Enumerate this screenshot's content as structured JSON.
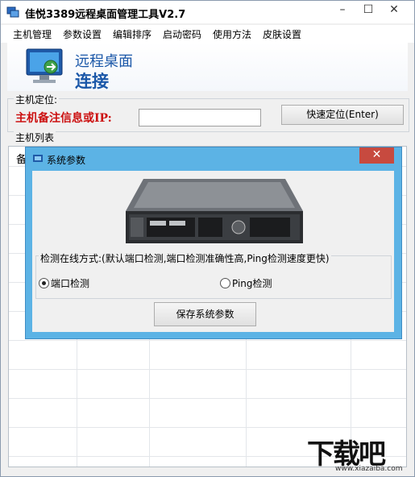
{
  "window": {
    "title": "佳悦3389远程桌面管理工具V2.7",
    "controls": {
      "minimize": "–",
      "maximize": "☐",
      "close": "✕"
    }
  },
  "menu": [
    {
      "label": "主机管理"
    },
    {
      "label": "参数设置"
    },
    {
      "label": "编辑排序"
    },
    {
      "label": "启动密码"
    },
    {
      "label": "使用方法"
    },
    {
      "label": "皮肤设置"
    }
  ],
  "banner": {
    "line1": "远程桌面",
    "line2": "连接",
    "icon": "remote-desktop-icon"
  },
  "locate": {
    "group_label": "主机定位:",
    "field_label": "主机备注信息或IP:",
    "input_value": "",
    "button_label": "快速定位(Enter)"
  },
  "host_list": {
    "group_label": "主机列表",
    "header_char": "备"
  },
  "dialog": {
    "title": "系统参数",
    "close": "✕",
    "image": "rack-server-image",
    "detect_label": "检测在线方式:(默认端口检测,端口检测准确性高,Ping检测速度更快)",
    "options": [
      {
        "label": "端口检测",
        "selected": true
      },
      {
        "label": "Ping检测",
        "selected": false
      }
    ],
    "save_button": "保存系统参数"
  },
  "watermark": {
    "text": "下载吧",
    "url": "www.xiazaiba.com"
  },
  "colors": {
    "accent": "#1a57a8",
    "red_label": "#cc1111",
    "dialog_frame": "#5cb3e5",
    "close_red": "#c74a3f"
  }
}
